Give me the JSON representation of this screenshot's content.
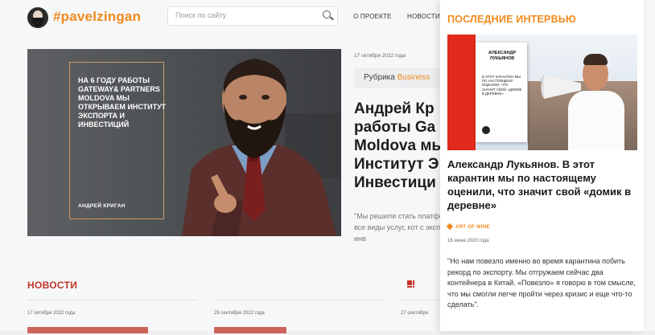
{
  "header": {
    "logo_text": "#pavelzingan",
    "search_placeholder": "Поиск по сайту",
    "nav": [
      "О ПРОЕКТЕ",
      "НОВОСТИ"
    ]
  },
  "hero": {
    "overlay_text": "НА 6 ГОДУ РАБОТЫ GATEWAY& PARTNERS MOLDOVA МЫ ОТКРЫВАЕМ ИНСТИТУТ ЭКСПОРТА И ИНВЕСТИЦИЙ",
    "name": "АНДРЕЙ КРИГАН"
  },
  "article": {
    "date": "17 октября 2022 года",
    "rubric_label": "Рубрика",
    "rubric_value": "Business",
    "title": "Андрей Кр работы Ga Moldova мы Институт Э Инвестици",
    "excerpt": "\"Мы решили стать платформы, где пр все виды услуг, кот с экспортом и с инв"
  },
  "news": {
    "heading": "НОВОСТИ",
    "dates": [
      "17 октября 2022 года",
      "29 сентября 2022 года",
      "27 сентября"
    ]
  },
  "interviews": {
    "heading": "ПОСЛЕДНИЕ ИНТЕРВЬЮ",
    "book_title": "АЛЕКСАНДР ЛУКЬЯНОВ",
    "book_subtitle": "В ЭТОТ КАРАНТИН МЫ ПО НАСТОЯЩЕМУ ОЦЕНИЛИ, ЧТО ЗНАЧИТ СВОЙ «ДОМИК В ДЕРЕВНЕ»",
    "title": "Александр Лукьянов. В этот карантин мы по настоящему оценили, что значит свой «домик в деревне»",
    "tag": "ART OF WINE",
    "date": "16 июня 2020 года",
    "quote": "\"Но нам повезло именно во время карантина побить рекорд по экспорту. Мы отгружаем сейчас два контейнера в Китай. «Повезло» я говорю в том смысле, что мы смогли легче пройти через кризис и еще что-то сделать\"."
  },
  "colors": {
    "accent": "#f08a1c",
    "news_red": "#c2332a",
    "book_red": "#e12a1b"
  }
}
